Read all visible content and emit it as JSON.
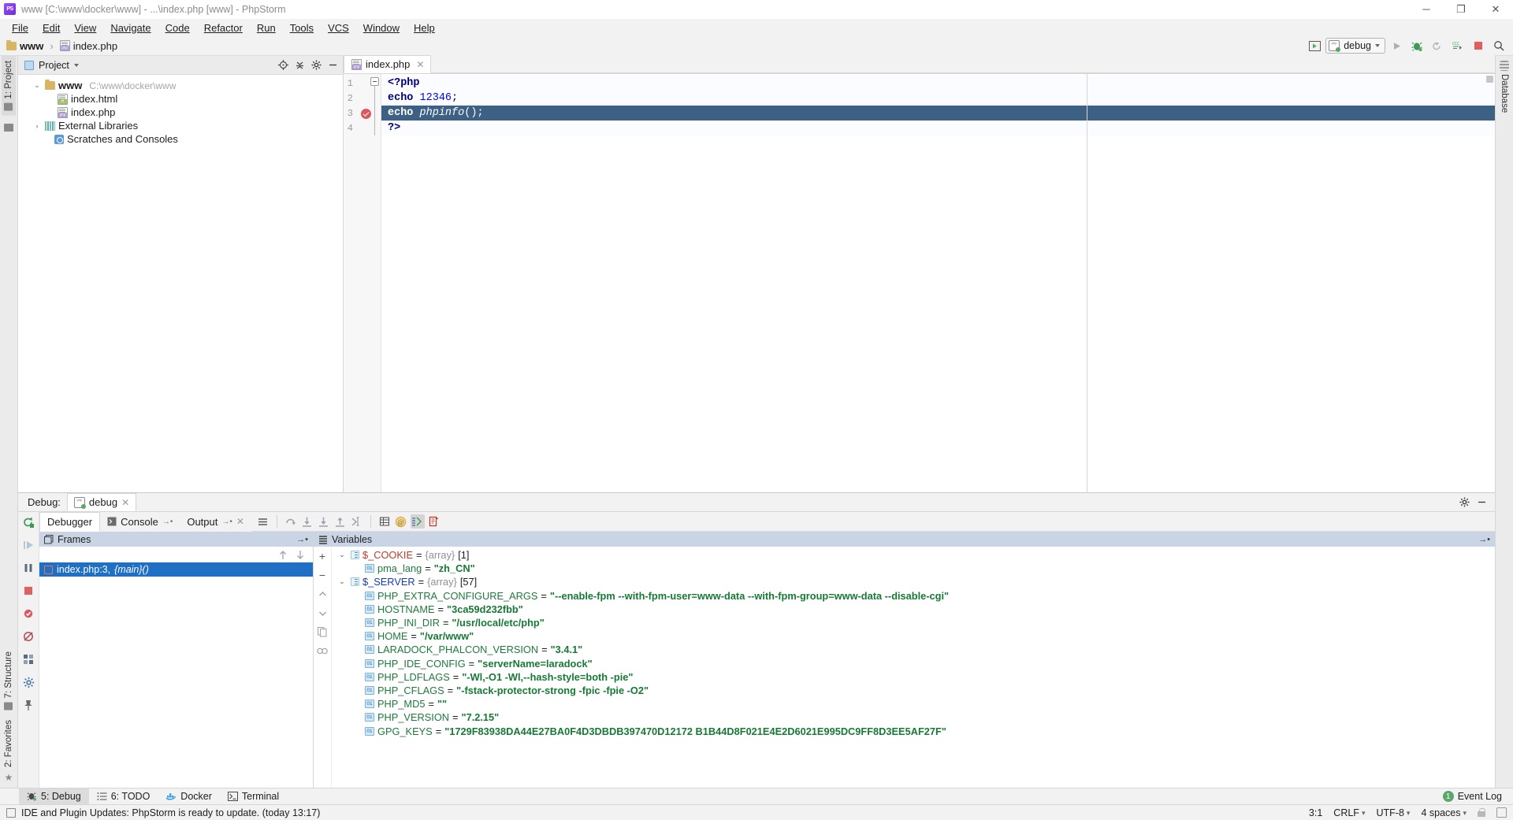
{
  "window": {
    "title": "www [C:\\www\\docker\\www] - ...\\index.php [www] - PhpStorm",
    "minimize": "─",
    "maximize": "❐",
    "close": "✕"
  },
  "menubar": {
    "items": [
      "File",
      "Edit",
      "View",
      "Navigate",
      "Code",
      "Refactor",
      "Run",
      "Tools",
      "VCS",
      "Window",
      "Help"
    ]
  },
  "breadcrumb": {
    "root": "www",
    "separator": "›",
    "file": "index.php"
  },
  "toolbar": {
    "run_config_name": "debug",
    "icons": [
      "select-run-config-icon",
      "run-icon",
      "debug-icon",
      "rerun-icon",
      "attach-icon",
      "stop-icon",
      "search-everywhere-icon"
    ]
  },
  "left_rail": {
    "project_tab": "1: Project",
    "structure_tab": "7: Structure",
    "favorites_tab": "2: Favorites"
  },
  "right_rail": {
    "database_tab": "Database"
  },
  "project": {
    "title": "Project",
    "tree": [
      {
        "label": "www",
        "path": "C:\\www\\docker\\www",
        "icon": "folder-icon",
        "indent": 0,
        "arrow": "⌄",
        "bold": true
      },
      {
        "label": "index.html",
        "path": "",
        "icon": "html-file-icon",
        "indent": 1,
        "arrow": "",
        "bold": false
      },
      {
        "label": "index.php",
        "path": "",
        "icon": "php-file-icon",
        "indent": 1,
        "arrow": "",
        "bold": false
      },
      {
        "label": "External Libraries",
        "path": "",
        "icon": "libraries-icon",
        "indent": 0,
        "arrow": "›",
        "bold": false
      },
      {
        "label": "Scratches and Consoles",
        "path": "",
        "icon": "scratches-icon",
        "indent": 0,
        "arrow": "",
        "bold": false
      }
    ]
  },
  "editor": {
    "tab_label": "index.php",
    "tab_close": "✕",
    "lines": [
      {
        "n": "1",
        "text": "<?php",
        "type": "open"
      },
      {
        "n": "2",
        "text": "echo 12346;",
        "type": "echo-num"
      },
      {
        "n": "3",
        "text": "echo phpinfo();",
        "type": "echo-fn",
        "highlighted": true,
        "breakpoint": true
      },
      {
        "n": "4",
        "text": "?>",
        "type": "close"
      }
    ],
    "tokens": {
      "php_open": "<?php",
      "php_close": "?>",
      "echo": "echo",
      "number": "12346",
      "semicolon": ";",
      "phpinfo": "phpinfo",
      "parens": "()"
    }
  },
  "debug": {
    "label": "Debug:",
    "session_tab": "debug",
    "session_close": "✕",
    "tabs": [
      {
        "label": "Debugger",
        "active": true,
        "close": ""
      },
      {
        "label": "Console",
        "active": false,
        "pin": "→•",
        "close": ""
      },
      {
        "label": "Output",
        "active": false,
        "pin": "→•",
        "close": "✕"
      }
    ],
    "frames_pane": {
      "title": "Frames",
      "pin": "→•"
    },
    "frames": [
      {
        "label": "index.php:3, ",
        "method": "{main}()",
        "selected": true
      }
    ],
    "variables_pane": {
      "title": "Variables",
      "pin": "→•"
    },
    "variables": [
      {
        "indent": 0,
        "arrow": "⌄",
        "icon": "array-icon",
        "name": "$_COOKIE",
        "name_color": "red",
        "eq": " = ",
        "type": "{array}",
        "count": "[1]",
        "value": ""
      },
      {
        "indent": 1,
        "arrow": "",
        "icon": "field-icon",
        "name": "pma_lang",
        "name_color": "green",
        "eq": " = ",
        "type": "",
        "count": "",
        "value": "\"zh_CN\""
      },
      {
        "indent": 0,
        "arrow": "⌄",
        "icon": "array-icon",
        "name": "$_SERVER",
        "name_color": "blue",
        "eq": " = ",
        "type": "{array}",
        "count": "[57]",
        "value": ""
      },
      {
        "indent": 1,
        "arrow": "",
        "icon": "field-icon",
        "name": "PHP_EXTRA_CONFIGURE_ARGS",
        "name_color": "green",
        "eq": " = ",
        "type": "",
        "count": "",
        "value": "\"--enable-fpm --with-fpm-user=www-data --with-fpm-group=www-data --disable-cgi\""
      },
      {
        "indent": 1,
        "arrow": "",
        "icon": "field-icon",
        "name": "HOSTNAME",
        "name_color": "green",
        "eq": " = ",
        "type": "",
        "count": "",
        "value": "\"3ca59d232fbb\""
      },
      {
        "indent": 1,
        "arrow": "",
        "icon": "field-icon",
        "name": "PHP_INI_DIR",
        "name_color": "green",
        "eq": " = ",
        "type": "",
        "count": "",
        "value": "\"/usr/local/etc/php\""
      },
      {
        "indent": 1,
        "arrow": "",
        "icon": "field-icon",
        "name": "HOME",
        "name_color": "green",
        "eq": " = ",
        "type": "",
        "count": "",
        "value": "\"/var/www\""
      },
      {
        "indent": 1,
        "arrow": "",
        "icon": "field-icon",
        "name": "LARADOCK_PHALCON_VERSION",
        "name_color": "green",
        "eq": " = ",
        "type": "",
        "count": "",
        "value": "\"3.4.1\""
      },
      {
        "indent": 1,
        "arrow": "",
        "icon": "field-icon",
        "name": "PHP_IDE_CONFIG",
        "name_color": "green",
        "eq": " = ",
        "type": "",
        "count": "",
        "value": "\"serverName=laradock\""
      },
      {
        "indent": 1,
        "arrow": "",
        "icon": "field-icon",
        "name": "PHP_LDFLAGS",
        "name_color": "green",
        "eq": " = ",
        "type": "",
        "count": "",
        "value": "\"-Wl,-O1 -Wl,--hash-style=both -pie\""
      },
      {
        "indent": 1,
        "arrow": "",
        "icon": "field-icon",
        "name": "PHP_CFLAGS",
        "name_color": "green",
        "eq": " = ",
        "type": "",
        "count": "",
        "value": "\"-fstack-protector-strong -fpic -fpie -O2\""
      },
      {
        "indent": 1,
        "arrow": "",
        "icon": "field-icon",
        "name": "PHP_MD5",
        "name_color": "green",
        "eq": " = ",
        "type": "",
        "count": "",
        "value": "\"\""
      },
      {
        "indent": 1,
        "arrow": "",
        "icon": "field-icon",
        "name": "PHP_VERSION",
        "name_color": "green",
        "eq": " = ",
        "type": "",
        "count": "",
        "value": "\"7.2.15\""
      },
      {
        "indent": 1,
        "arrow": "",
        "icon": "field-icon",
        "name": "GPG_KEYS",
        "name_color": "green",
        "eq": " = ",
        "type": "",
        "count": "",
        "value": "\"1729F83938DA44E27BA0F4D3DBDB397470D12172 B1B44D8F021E4E2D6021E995DC9FF8D3EE5AF27F\""
      }
    ]
  },
  "bottom_tabs": [
    {
      "label": "5: Debug",
      "underline": "5",
      "icon": "bug-icon",
      "active": true
    },
    {
      "label": "6: TODO",
      "underline": "6",
      "icon": "todo-icon",
      "active": false
    },
    {
      "label": "Docker",
      "underline": "",
      "icon": "docker-icon",
      "active": false
    },
    {
      "label": "Terminal",
      "underline": "",
      "icon": "terminal-icon",
      "active": false
    }
  ],
  "event_log": {
    "label": "Event Log",
    "count": "1"
  },
  "statusbar": {
    "message": "IDE and Plugin Updates: PhpStorm is ready to update. (today 13:17)",
    "caret": "3:1",
    "line_sep": "CRLF",
    "encoding": "UTF-8",
    "indent": "4 spaces",
    "lock": "lock-icon",
    "train": "memory-icon"
  },
  "colors": {
    "selection_blue": "#3d6185",
    "frame_blue": "#1f6fc4",
    "pane_header": "#c9d5e5",
    "value_green": "#167a35",
    "name_red": "#c0392b",
    "name_blue": "#1a39b5",
    "breakpoint_red": "#db5860"
  }
}
